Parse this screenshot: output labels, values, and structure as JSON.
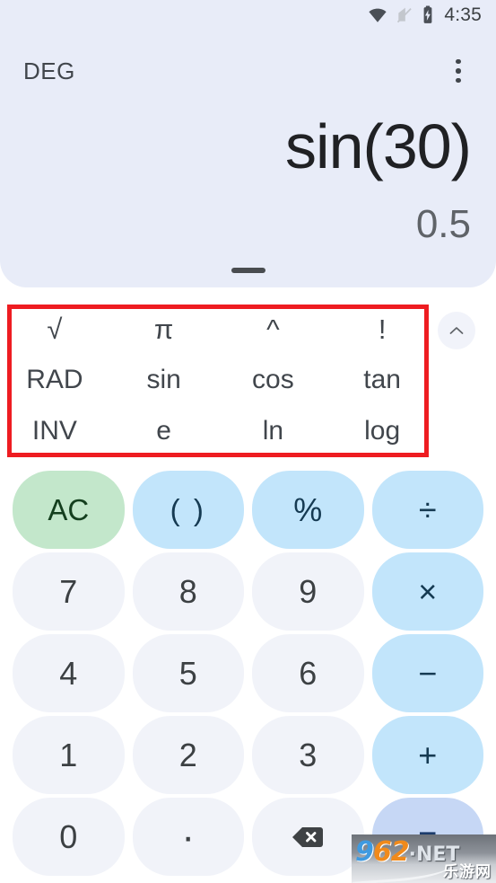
{
  "status_bar": {
    "time": "4:35",
    "icons": [
      "wifi-icon",
      "no-sim-icon",
      "battery-charging-icon"
    ]
  },
  "header": {
    "angle_mode": "DEG",
    "overflow_menu": "more-options"
  },
  "display": {
    "expression": "sin(30)",
    "result": "0.5",
    "drag_handle": "display-drag-handle"
  },
  "scientific_pad": {
    "collapse_icon": "chevron-up-icon",
    "rows": [
      [
        {
          "label": "√",
          "name": "sqrt"
        },
        {
          "label": "π",
          "name": "pi"
        },
        {
          "label": "^",
          "name": "power"
        },
        {
          "label": "!",
          "name": "factorial"
        }
      ],
      [
        {
          "label": "RAD",
          "name": "rad"
        },
        {
          "label": "sin",
          "name": "sin"
        },
        {
          "label": "cos",
          "name": "cos"
        },
        {
          "label": "tan",
          "name": "tan"
        }
      ],
      [
        {
          "label": "INV",
          "name": "inv"
        },
        {
          "label": "e",
          "name": "e"
        },
        {
          "label": "ln",
          "name": "ln"
        },
        {
          "label": "log",
          "name": "log"
        }
      ]
    ]
  },
  "keypad": {
    "rows": [
      [
        {
          "label": "AC",
          "name": "clear",
          "style": "clear"
        },
        {
          "label": "( )",
          "name": "parentheses",
          "style": "paren"
        },
        {
          "label": "%",
          "name": "percent",
          "style": "op"
        },
        {
          "label": "÷",
          "name": "divide",
          "style": "op"
        }
      ],
      [
        {
          "label": "7",
          "name": "seven",
          "style": "digit"
        },
        {
          "label": "8",
          "name": "eight",
          "style": "digit"
        },
        {
          "label": "9",
          "name": "nine",
          "style": "digit"
        },
        {
          "label": "×",
          "name": "multiply",
          "style": "op"
        }
      ],
      [
        {
          "label": "4",
          "name": "four",
          "style": "digit"
        },
        {
          "label": "5",
          "name": "five",
          "style": "digit"
        },
        {
          "label": "6",
          "name": "six",
          "style": "digit"
        },
        {
          "label": "−",
          "name": "subtract",
          "style": "op"
        }
      ],
      [
        {
          "label": "1",
          "name": "one",
          "style": "digit"
        },
        {
          "label": "2",
          "name": "two",
          "style": "digit"
        },
        {
          "label": "3",
          "name": "three",
          "style": "digit"
        },
        {
          "label": "+",
          "name": "add",
          "style": "op"
        }
      ],
      [
        {
          "label": "0",
          "name": "zero",
          "style": "digit"
        },
        {
          "label": "·",
          "name": "decimal-point",
          "style": "dot"
        },
        {
          "label": "",
          "name": "backspace",
          "style": "digit",
          "icon": "backspace-icon"
        },
        {
          "label": "=",
          "name": "equals",
          "style": "equals"
        }
      ]
    ]
  },
  "annotation": {
    "highlight_color": "#ee1c21",
    "target": "scientific-function-pad"
  },
  "watermark": {
    "digit_blue": "9",
    "digits_orange": "62",
    "domain": "·NET",
    "subtitle": "乐游网"
  },
  "colors": {
    "display_bg": "#e8ecf8",
    "digit_key": "#f1f3f9",
    "operator_key": "#c2e5fb",
    "clear_key": "#c3e7cb",
    "equals_key": "#c6d7f5"
  }
}
